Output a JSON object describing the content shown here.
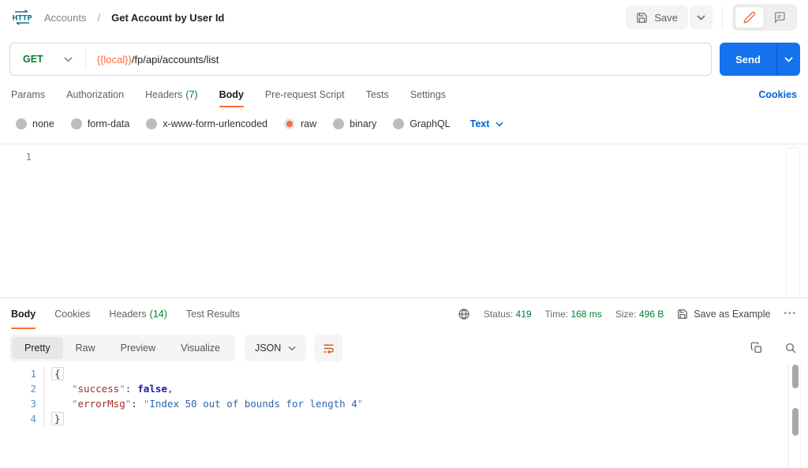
{
  "colors": {
    "accent_orange": "#FF6C37",
    "method_green": "#007F31",
    "link_blue": "#0265D2",
    "send_blue": "#1372EC"
  },
  "header": {
    "breadcrumb": {
      "parent": "Accounts",
      "separator": "/",
      "current": "Get Account by User Id"
    },
    "save_button": "Save"
  },
  "request": {
    "method": "GET",
    "url": {
      "variable": "{{local}}",
      "path": "/fp/api/accounts/list"
    },
    "send": "Send",
    "tabs": [
      {
        "label": "Params"
      },
      {
        "label": "Authorization"
      },
      {
        "label": "Headers",
        "count": "(7)"
      },
      {
        "label": "Body"
      },
      {
        "label": "Pre-request Script"
      },
      {
        "label": "Tests"
      },
      {
        "label": "Settings"
      }
    ],
    "cookies_link": "Cookies",
    "body_modes": [
      "none",
      "form-data",
      "x-www-form-urlencoded",
      "raw",
      "binary",
      "GraphQL"
    ],
    "selected_mode": "raw",
    "raw_language": "Text",
    "editor": {
      "line_number": "1"
    }
  },
  "response": {
    "tabs": [
      {
        "label": "Body"
      },
      {
        "label": "Cookies"
      },
      {
        "label": "Headers",
        "count": "(14)"
      },
      {
        "label": "Test Results"
      }
    ],
    "meta": {
      "status_label": "Status:",
      "status_value": "419",
      "time_label": "Time:",
      "time_value": "168 ms",
      "size_label": "Size:",
      "size_value": "496 B"
    },
    "save_as_example": "Save as Example",
    "more_options_icon": "•••",
    "view_tabs": [
      "Pretty",
      "Raw",
      "Preview",
      "Visualize"
    ],
    "active_view": "Pretty",
    "format": "JSON",
    "body": {
      "line_numbers": [
        "1",
        "2",
        "3",
        "4"
      ],
      "quote": "\"",
      "open_brace": "{",
      "close_brace": "}",
      "entries": [
        {
          "key": "success",
          "colon": ":",
          "value": "false",
          "comma": ","
        },
        {
          "key": "errorMsg",
          "colon": ":",
          "value": "Index 50 out of bounds for length 4"
        }
      ]
    }
  }
}
